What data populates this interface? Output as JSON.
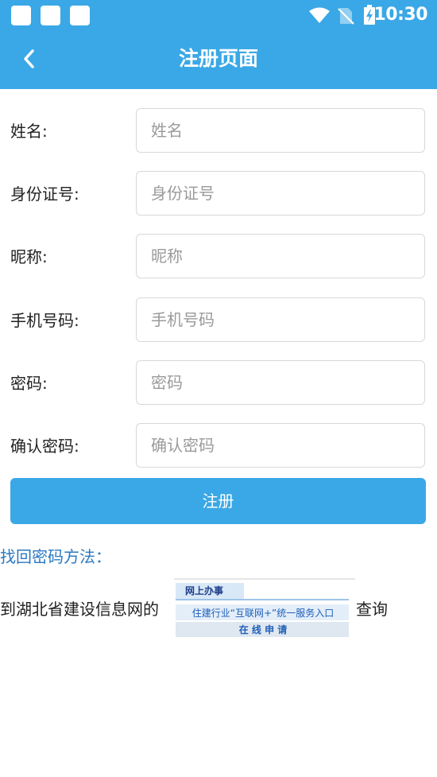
{
  "status": {
    "time": "10:30"
  },
  "header": {
    "title": "注册页面"
  },
  "form": {
    "fields": [
      {
        "label": "姓名:",
        "placeholder": "姓名"
      },
      {
        "label": "身份证号:",
        "placeholder": "身份证号"
      },
      {
        "label": "昵称:",
        "placeholder": "昵称"
      },
      {
        "label": "手机号码:",
        "placeholder": "手机号码"
      },
      {
        "label": "密码:",
        "placeholder": "密码"
      },
      {
        "label": "确认密码:",
        "placeholder": "确认密码"
      }
    ],
    "submit_label": "注册"
  },
  "recover": {
    "heading": "找回密码方法：",
    "prefix": "到湖北省建设信息网的",
    "suffix": "查询",
    "banner": {
      "tab": "网上办事",
      "line1": "住建行业“互联网+”统一服务入口",
      "line2": "在 线 申 请"
    }
  },
  "colors": {
    "primary": "#3aa8e6",
    "link": "#2a78c2"
  },
  "icons": {
    "back": "chevron-left-icon",
    "wifi": "wifi-icon",
    "no_sim": "no-sim-icon",
    "battery": "battery-charging-icon"
  }
}
